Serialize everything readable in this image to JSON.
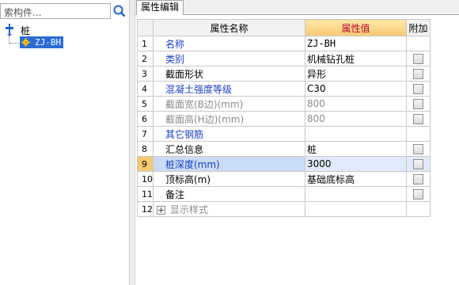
{
  "search": {
    "placeholder": "索构件..."
  },
  "tree": {
    "root_label": "桩",
    "child_label": "ZJ-BH"
  },
  "panel": {
    "tab_title": "属性编辑"
  },
  "grid": {
    "headers": {
      "name": "属性名称",
      "value": "属性值",
      "extra": "附加"
    },
    "rows": [
      {
        "no": "1",
        "name": "名称",
        "value": "ZJ-BH",
        "style": "blue",
        "checkbox": false
      },
      {
        "no": "2",
        "name": "类别",
        "value": "机械钻孔桩",
        "style": "blue",
        "checkbox": true
      },
      {
        "no": "3",
        "name": "截面形状",
        "value": "异形",
        "style": "black",
        "checkbox": true
      },
      {
        "no": "4",
        "name": "混凝土强度等级",
        "value": "C30",
        "style": "blue",
        "checkbox": true
      },
      {
        "no": "5",
        "name": "截面宽(B边)(mm)",
        "value": "800",
        "style": "gray",
        "checkbox": true
      },
      {
        "no": "6",
        "name": "截面高(H边)(mm)",
        "value": "800",
        "style": "gray",
        "checkbox": true
      },
      {
        "no": "7",
        "name": "其它钢筋",
        "value": "",
        "style": "blue",
        "checkbox": false
      },
      {
        "no": "8",
        "name": "汇总信息",
        "value": "桩",
        "style": "black",
        "checkbox": true
      },
      {
        "no": "9",
        "name": "桩深度(mm)",
        "value": "3000",
        "style": "blue",
        "checkbox": true,
        "selected": true
      },
      {
        "no": "10",
        "name": "顶标高(m)",
        "value": "基础底标高",
        "style": "black",
        "checkbox": true
      },
      {
        "no": "11",
        "name": "备注",
        "value": "",
        "style": "black",
        "checkbox": true
      },
      {
        "no": "12",
        "name": "显示样式",
        "value": "",
        "style": "gray",
        "checkbox": false,
        "expandable": true
      }
    ]
  }
}
